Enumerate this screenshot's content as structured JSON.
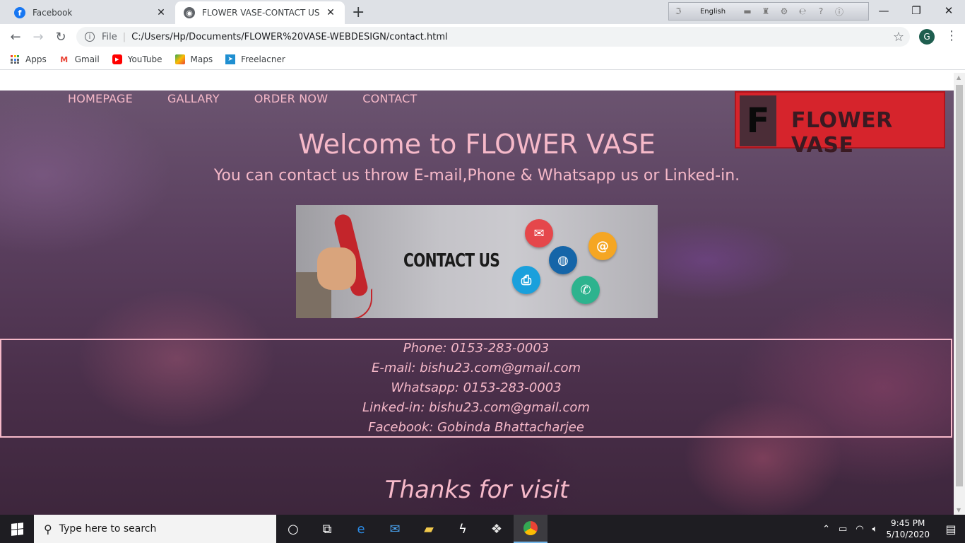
{
  "browser": {
    "tabs": [
      {
        "title": "Facebook",
        "favicon": "facebook-icon",
        "active": false
      },
      {
        "title": "FLOWER VASE-CONTACT US",
        "favicon": "globe-icon",
        "active": true
      }
    ],
    "language_bar": {
      "language": "English"
    },
    "address": {
      "scheme_label": "File",
      "url": "C:/Users/Hp/Documents/FLOWER%20VASE-WEBDESIGN/contact.html"
    },
    "profile_initial": "G",
    "bookmarks": [
      {
        "label": "Apps",
        "icon": "apps-grid-icon"
      },
      {
        "label": "Gmail",
        "icon": "gmail-icon"
      },
      {
        "label": "YouTube",
        "icon": "youtube-icon"
      },
      {
        "label": "Maps",
        "icon": "maps-icon"
      },
      {
        "label": "Freelacner",
        "icon": "freelancer-icon"
      }
    ]
  },
  "site": {
    "nav": [
      "HOMEPAGE",
      "GALLARY",
      "ORDER NOW",
      "CONTACT"
    ],
    "logo": {
      "letter": "F",
      "text": "FLOWER VASE"
    },
    "welcome": "Welcome to FLOWER VASE",
    "subline": "You can contact us throw E-mail,Phone & Whatsapp us or Linked-in.",
    "banner": {
      "label": "CONTACT US",
      "icons": [
        "mail-icon",
        "at-icon",
        "globe-icon",
        "fax-icon",
        "phone-icon"
      ]
    },
    "contacts": [
      "Phone: 0153-283-0003",
      "E-mail: bishu23.com@gmail.com",
      "Whatsapp: 0153-283-0003",
      "Linked-in: bishu23.com@gmail.com",
      "Facebook: Gobinda Bhattacharjee"
    ],
    "thanks": "Thanks for visit",
    "colors": {
      "accent_pink": "#f6b9c9",
      "logo_red": "#d6242c"
    }
  },
  "taskbar": {
    "search_placeholder": "Type here to search",
    "time": "9:45 PM",
    "date": "5/10/2020"
  }
}
